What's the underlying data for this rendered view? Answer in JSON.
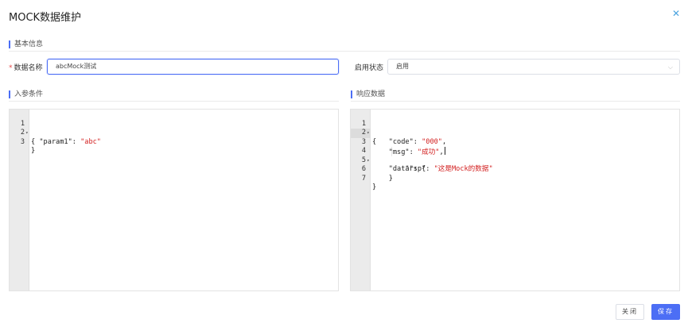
{
  "dialog": {
    "title": "MOCK数据维护",
    "close_icon": "close-icon"
  },
  "basic_info": {
    "section_title": "基本信息",
    "name_label": "数据名称",
    "name_required_mark": "*",
    "name_value": "abcMock测试",
    "status_label": "启用状态",
    "status_value": "启用"
  },
  "request_params": {
    "section_title": "入参条件",
    "lines": [
      {
        "no": "1",
        "fold": true,
        "text": "{"
      },
      {
        "no": "2",
        "fold": false,
        "key": "  \"param1\": ",
        "str": "\"abc\""
      },
      {
        "no": "3",
        "fold": false,
        "text": "}"
      }
    ]
  },
  "response_data": {
    "section_title": "响应数据",
    "lines": [
      {
        "no": "1",
        "fold": true,
        "text": "{"
      },
      {
        "no": "2",
        "fold": false,
        "key": "    \"code\": ",
        "str": "\"000\"",
        "tail": ","
      },
      {
        "no": "3",
        "fold": false,
        "key": "    \"msg\": ",
        "str": "\"成功\"",
        "tail": ","
      },
      {
        "no": "4",
        "fold": true,
        "text": "    \"data\": {"
      },
      {
        "no": "5",
        "fold": false,
        "key": "        \"rsp\": ",
        "str": "\"这是Mock的数据\""
      },
      {
        "no": "6",
        "fold": false,
        "text": "    }"
      },
      {
        "no": "7",
        "fold": false,
        "text": "}"
      }
    ]
  },
  "footer": {
    "close_label": "关闭",
    "save_label": "保存"
  },
  "colors": {
    "accent": "#4c6ef5",
    "string": "#d21d1d",
    "close_icon": "#4aa3df"
  }
}
